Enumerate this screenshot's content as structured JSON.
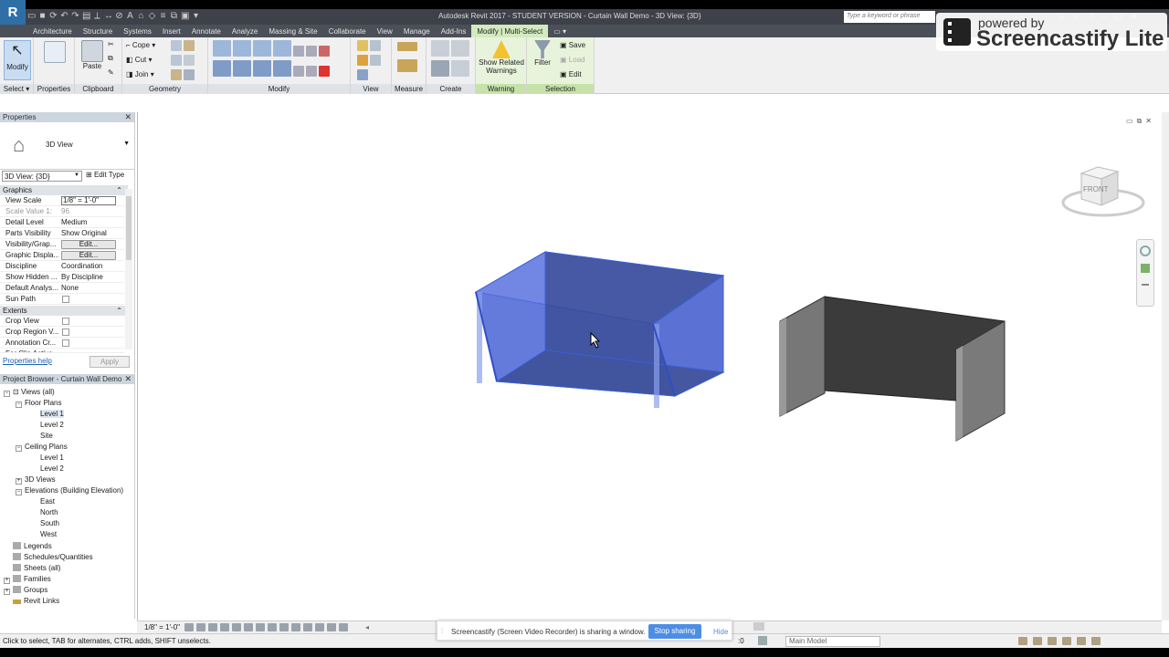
{
  "app": {
    "logo": "R",
    "title": "Autodesk Revit 2017 - STUDENT VERSION -     Curtain Wall Demo - 3D View: {3D}",
    "search_placeholder": "Type a keyword or phrase"
  },
  "tabs": [
    "Architecture",
    "Structure",
    "Systems",
    "Insert",
    "Annotate",
    "Analyze",
    "Massing & Site",
    "Collaborate",
    "View",
    "Manage",
    "Add-Ins",
    "Modify | Multi-Select"
  ],
  "ribbon": {
    "modify_label": "Modify",
    "select_label": "Select",
    "properties_label": "Properties",
    "paste_label": "Paste",
    "clipboard_label": "Clipboard",
    "cope_label": "Cope",
    "cut_label": "Cut",
    "join_label": "Join",
    "geometry_label": "Geometry",
    "modify_panel_label": "Modify",
    "view_label": "View",
    "measure_label": "Measure",
    "create_label": "Create",
    "show_related_label": "Show Related",
    "warnings_label": "Warnings",
    "warning_panel_label": "Warning",
    "filter_label": "Filter",
    "save_label": "Save",
    "load_label": "Load",
    "edit_label": "Edit",
    "selection_label": "Selection"
  },
  "properties": {
    "header": "Properties",
    "type_name": "3D View",
    "view_dropdown": "3D View: {3D}",
    "edit_type": "Edit Type",
    "graphics_label": "Graphics",
    "extents_label": "Extents",
    "rows": [
      {
        "key": "View Scale",
        "value": "1/8\" = 1'-0\""
      },
      {
        "key": "Scale Value    1:",
        "value": "96"
      },
      {
        "key": "Detail Level",
        "value": "Medium"
      },
      {
        "key": "Parts Visibility",
        "value": "Show Original"
      },
      {
        "key": "Visibility/Grap...",
        "value": "Edit..."
      },
      {
        "key": "Graphic Displa...",
        "value": "Edit..."
      },
      {
        "key": "Discipline",
        "value": "Coordination"
      },
      {
        "key": "Show Hidden ...",
        "value": "By Discipline"
      },
      {
        "key": "Default Analys...",
        "value": "None"
      },
      {
        "key": "Sun Path",
        "value": ""
      }
    ],
    "extents_rows": [
      {
        "key": "Crop View"
      },
      {
        "key": "Crop Region V..."
      },
      {
        "key": "Annotation Cr..."
      },
      {
        "key": "Far Clip Active"
      }
    ],
    "help_link": "Properties help",
    "apply": "Apply"
  },
  "browser": {
    "header": "Project Browser - Curtain Wall Demo",
    "views_all": "Views (all)",
    "floor_plans": "Floor Plans",
    "fp_level1": "Level 1",
    "fp_level2": "Level 2",
    "fp_site": "Site",
    "ceiling_plans": "Ceiling Plans",
    "cp_level1": "Level 1",
    "cp_level2": "Level 2",
    "views_3d": "3D Views",
    "elevations": "Elevations (Building Elevation)",
    "east": "East",
    "north": "North",
    "south": "South",
    "west": "West",
    "legends": "Legends",
    "schedules": "Schedules/Quantities",
    "sheets": "Sheets (all)",
    "families": "Families",
    "groups": "Groups",
    "revit_links": "Revit Links"
  },
  "viewcube": {
    "face_label": "FRONT"
  },
  "view_control": {
    "scale": "1/8\" = 1'-0\""
  },
  "status": {
    "text": "Click to select, TAB for alternates, CTRL adds, SHIFT unselects.",
    "zero": ":0",
    "model": "Main Model"
  },
  "share": {
    "message": "Screencastify (Screen Video Recorder) is sharing a window.",
    "stop": "Stop sharing",
    "hide": "Hide"
  },
  "watermark": {
    "line1": "powered by",
    "line2": "Screencastify Lite"
  },
  "colors": {
    "selection_blue": "#3b5fd6",
    "wall_grey": "#7a7a7a",
    "modify_tab": "#d3eabe"
  }
}
